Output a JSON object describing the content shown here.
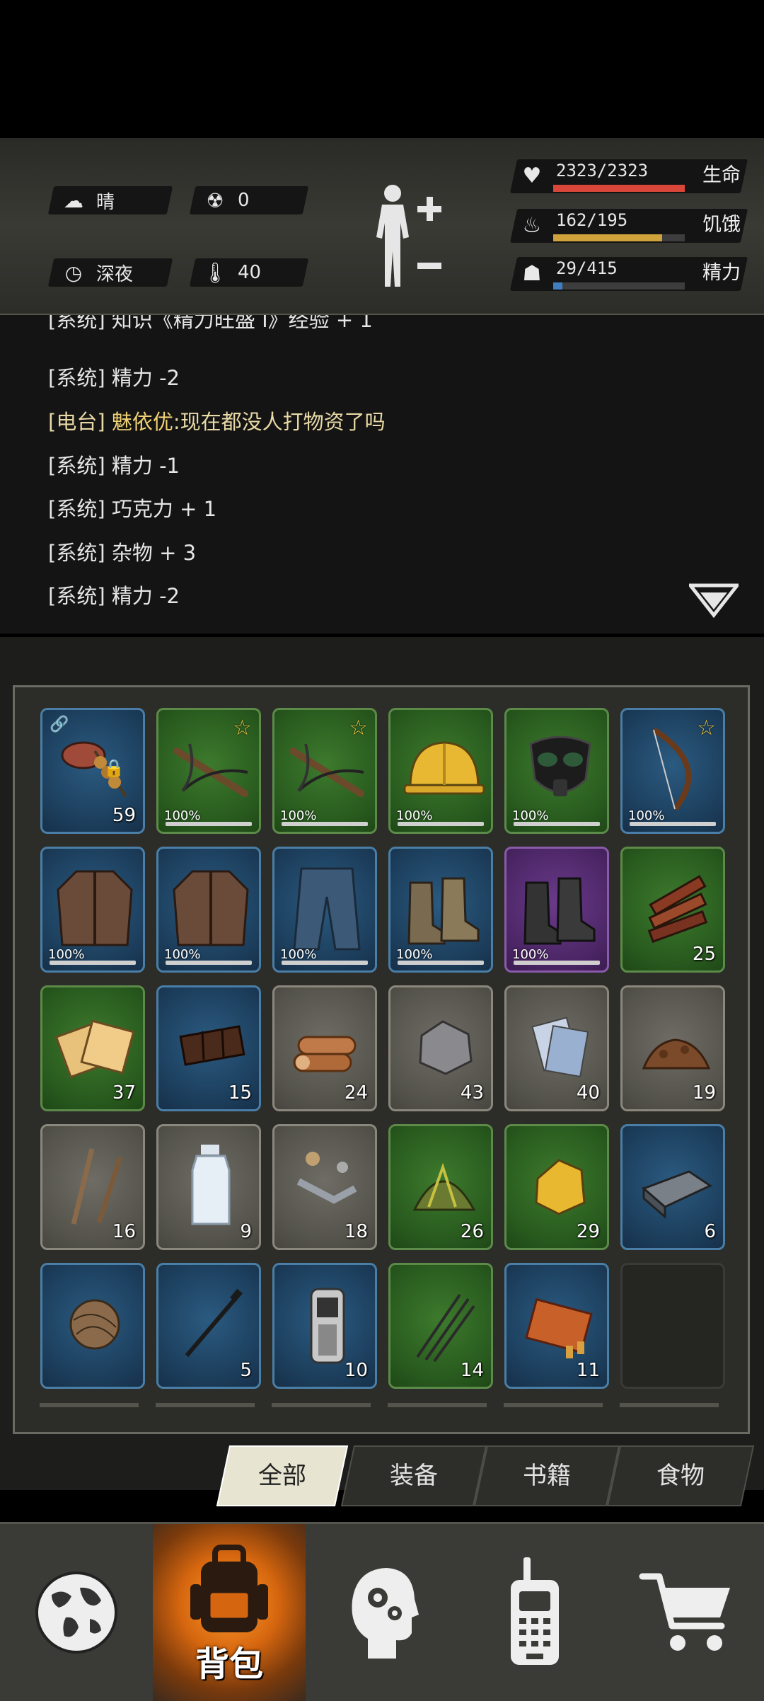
{
  "status": {
    "weather": "晴",
    "radiation": "0",
    "time_of_day": "深夜",
    "temperature": "40",
    "health": {
      "text": "2323/2323",
      "label": "生命",
      "fraction": 1.0,
      "color": "#d9473a"
    },
    "hunger": {
      "text": "162/195",
      "label": "饥饿",
      "fraction": 0.83,
      "color": "#d0a23c"
    },
    "energy": {
      "text": "29/415",
      "label": "精力",
      "fraction": 0.07,
      "color": "#3f7fc0"
    }
  },
  "log": {
    "partial_line": "[系统] 知识《精力旺盛 I》经验 + 1",
    "lines": [
      {
        "text": "[系统] 精力 -2"
      },
      {
        "prefix": "[电台] ",
        "speaker": "魅依优",
        "text": ":现在都没人打物资了吗"
      },
      {
        "text": "[系统] 精力 -1"
      },
      {
        "text": "[系统] 巧克力 + 1"
      },
      {
        "text": "[系统] 杂物 + 3"
      },
      {
        "text": "[系统] 精力 -2"
      }
    ]
  },
  "inventory": {
    "items": [
      {
        "name": "meat-skewer",
        "rarity": "blue",
        "count": "59",
        "linked": true,
        "locked": true
      },
      {
        "name": "crossbow",
        "rarity": "green",
        "durability": "100%",
        "starred": true
      },
      {
        "name": "crossbow",
        "rarity": "green",
        "durability": "100%",
        "starred": true
      },
      {
        "name": "hard-hat",
        "rarity": "green",
        "durability": "100%"
      },
      {
        "name": "gas-mask",
        "rarity": "green",
        "durability": "100%"
      },
      {
        "name": "bow",
        "rarity": "blue",
        "durability": "100%",
        "starred": true
      },
      {
        "name": "leather-jacket",
        "rarity": "blue",
        "durability": "100%"
      },
      {
        "name": "leather-jacket",
        "rarity": "blue",
        "durability": "100%"
      },
      {
        "name": "jeans",
        "rarity": "blue",
        "durability": "100%"
      },
      {
        "name": "boots",
        "rarity": "blue",
        "durability": "100%"
      },
      {
        "name": "combat-boots",
        "rarity": "purple",
        "durability": "100%"
      },
      {
        "name": "firewood",
        "rarity": "green",
        "count": "25"
      },
      {
        "name": "crackers",
        "rarity": "green",
        "count": "37"
      },
      {
        "name": "chocolate",
        "rarity": "blue",
        "count": "15"
      },
      {
        "name": "logs",
        "rarity": "gray",
        "count": "24"
      },
      {
        "name": "stone",
        "rarity": "gray",
        "count": "43"
      },
      {
        "name": "paper",
        "rarity": "gray",
        "count": "40"
      },
      {
        "name": "soil",
        "rarity": "gray",
        "count": "19"
      },
      {
        "name": "sticks",
        "rarity": "gray",
        "count": "16"
      },
      {
        "name": "water-bottle",
        "rarity": "gray",
        "count": "9"
      },
      {
        "name": "scrap",
        "rarity": "gray",
        "count": "18"
      },
      {
        "name": "herbs",
        "rarity": "green",
        "count": "26"
      },
      {
        "name": "gold-ore",
        "rarity": "green",
        "count": "29"
      },
      {
        "name": "iron-ingot",
        "rarity": "blue",
        "count": "6"
      },
      {
        "name": "twine",
        "rarity": "blue",
        "count": ""
      },
      {
        "name": "nail",
        "rarity": "blue",
        "count": "5"
      },
      {
        "name": "cellphone",
        "rarity": "blue",
        "count": "10"
      },
      {
        "name": "arrows",
        "rarity": "green",
        "count": "14"
      },
      {
        "name": "ammo-box",
        "rarity": "blue",
        "count": "11"
      },
      {
        "name": "empty",
        "rarity": "empty"
      }
    ]
  },
  "tabs": [
    "全部",
    "装备",
    "书籍",
    "食物"
  ],
  "nav": {
    "backpack_label": "背包"
  }
}
